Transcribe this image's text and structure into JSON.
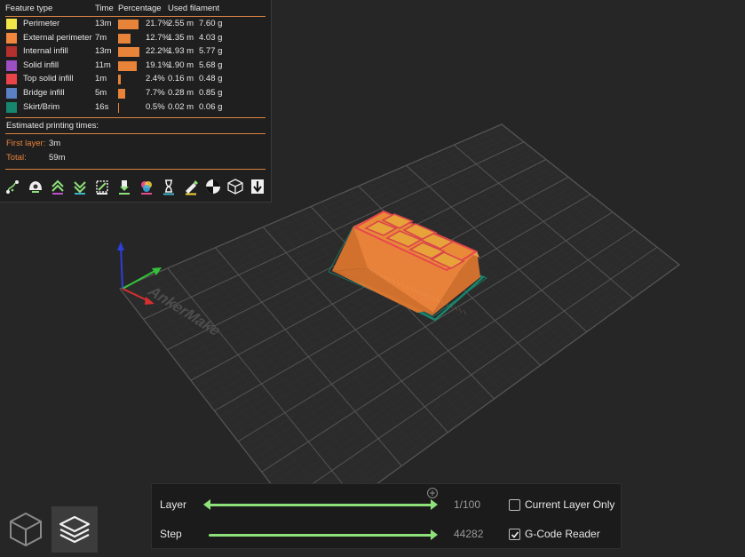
{
  "legend": {
    "headers": {
      "feature_type": "Feature type",
      "time": "Time",
      "percentage": "Percentage",
      "used_filament": "Used filament"
    },
    "rows": [
      {
        "name": "Perimeter",
        "color": "#f2e64a",
        "time": "13m",
        "percent": "21.7%",
        "percent_value": 21.7,
        "length": "2.55 m",
        "weight": "7.60 g"
      },
      {
        "name": "External perimeter",
        "color": "#f0873c",
        "time": "7m",
        "percent": "12.7%",
        "percent_value": 12.7,
        "length": "1.35 m",
        "weight": "4.03 g"
      },
      {
        "name": "Internal infill",
        "color": "#b3302f",
        "time": "13m",
        "percent": "22.2%",
        "percent_value": 22.2,
        "length": "1.93 m",
        "weight": "5.77 g"
      },
      {
        "name": "Solid infill",
        "color": "#9b4fc2",
        "time": "11m",
        "percent": "19.1%",
        "percent_value": 19.1,
        "length": "1.90 m",
        "weight": "5.68 g"
      },
      {
        "name": "Top solid infill",
        "color": "#e8444a",
        "time": "1m",
        "percent": "2.4%",
        "percent_value": 2.4,
        "length": "0.16 m",
        "weight": "0.48 g"
      },
      {
        "name": "Bridge infill",
        "color": "#5b80c4",
        "time": "5m",
        "percent": "7.7%",
        "percent_value": 7.7,
        "length": "0.28 m",
        "weight": "0.85 g"
      },
      {
        "name": "Skirt/Brim",
        "color": "#17866e",
        "time": "16s",
        "percent": "0.5%",
        "percent_value": 0.5,
        "length": "0.02 m",
        "weight": "0.06 g"
      }
    ],
    "estimated_label": "Estimated printing times:",
    "first_layer_label": "First layer:",
    "first_layer_value": "3m",
    "total_label": "Total:",
    "total_value": "59m"
  },
  "toolbar_icons": [
    "travel-icon",
    "wipe-icon",
    "retractions-icon",
    "deretractions-icon",
    "seams-icon",
    "tool-changes-icon",
    "color-changes-icon",
    "pause-prints-icon",
    "custom-gcode-icon",
    "center-of-gravity-icon",
    "shells-icon",
    "tool-marker-icon"
  ],
  "bed": {
    "watermark": "AnkerMake"
  },
  "sliders": {
    "layer_label": "Layer",
    "layer_value": "1/100",
    "layer_position": 1,
    "layer_max": 100,
    "step_label": "Step",
    "step_value": "44282",
    "step_fraction": 1.0,
    "current_layer_only_label": "Current Layer Only",
    "current_layer_only_checked": false,
    "gcode_reader_label": "G-Code Reader",
    "gcode_reader_checked": true
  },
  "colors": {
    "accent": "#e8833a",
    "slider": "#8ee07a",
    "model": "#e8823a"
  }
}
